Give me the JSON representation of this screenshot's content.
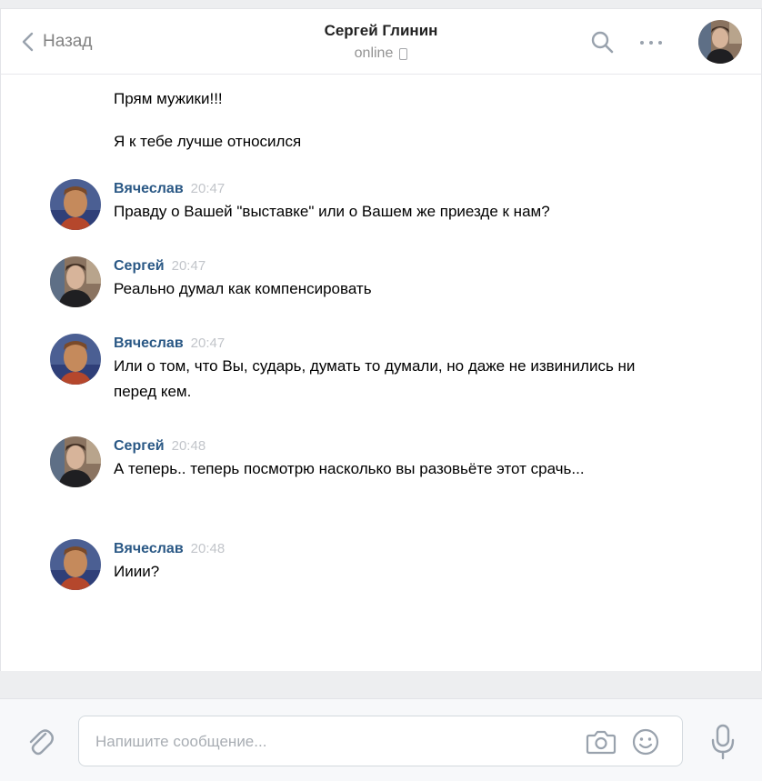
{
  "header": {
    "back_label": "Назад",
    "contact_name": "Сергей Глинин",
    "status": "online"
  },
  "messages": {
    "continued": [
      {
        "text": "Прям мужики!!!"
      },
      {
        "text": "Я к тебе лучше относился"
      }
    ],
    "items": [
      {
        "author": "Вячеслав",
        "time": "20:47",
        "text": "Правду о Вашей \"выставке\" или о Вашем же приезде к нам?"
      },
      {
        "author": "Сергей",
        "time": "20:47",
        "text": "Реально думал как компенсировать"
      },
      {
        "author": "Вячеслав",
        "time": "20:47",
        "text": "Или о том, что Вы, сударь, думать то думали, но даже не извинились ни перед кем."
      },
      {
        "author": "Сергей",
        "time": "20:48",
        "text": "А теперь.. теперь посмотрю насколько вы разовьёте этот срачь..."
      },
      {
        "author": "Вячеслав",
        "time": "20:48",
        "text": "Ииии?"
      }
    ]
  },
  "composer": {
    "placeholder": "Напишите сообщение..."
  },
  "colors": {
    "author_link": "#2a5885",
    "timestamp": "#c2c5ca",
    "icon": "#99a2ad",
    "background": "#edeef0"
  },
  "icons": [
    "back-chevron-icon",
    "phone-icon",
    "search-icon",
    "more-icon",
    "paperclip-icon",
    "camera-icon",
    "emoji-icon",
    "microphone-icon"
  ]
}
